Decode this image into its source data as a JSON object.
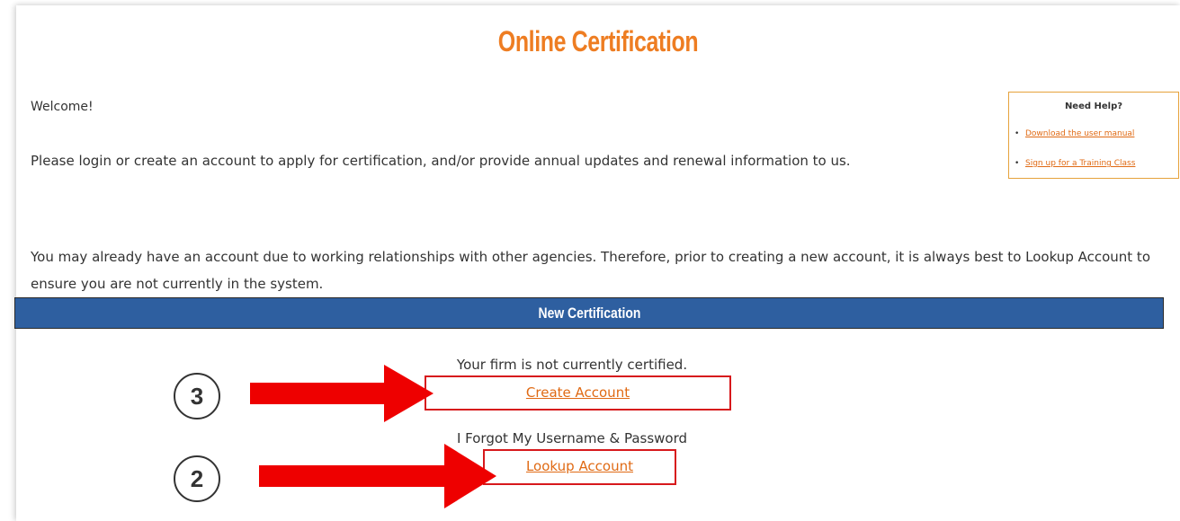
{
  "page": {
    "title": "Online Certification",
    "welcome": "Welcome!",
    "intro": "Please login or create an account to apply for certification, and/or provide annual updates and renewal information to us.",
    "notice": "You may already have an account due to working relationships with other agencies. Therefore, prior to creating a new account, it is always best to Lookup Account to ensure you are not currently in the system."
  },
  "help": {
    "title": "Need Help?",
    "links": [
      "Download the user manual",
      "Sign up for a Training Class"
    ]
  },
  "new_cert": {
    "header": "New Certification",
    "not_certified": "Your firm is not currently certified.",
    "create_account": "Create Account",
    "forgot": "I Forgot My Username & Password",
    "lookup_account": "Lookup Account"
  },
  "annotations": {
    "step_create": "3",
    "step_lookup": "2",
    "highlight_color": "#d7191c",
    "arrow_color": "#ee0000"
  },
  "colors": {
    "accent": "#ee7d22",
    "link": "#e06a14",
    "header_bar": "#2e5fa0"
  }
}
